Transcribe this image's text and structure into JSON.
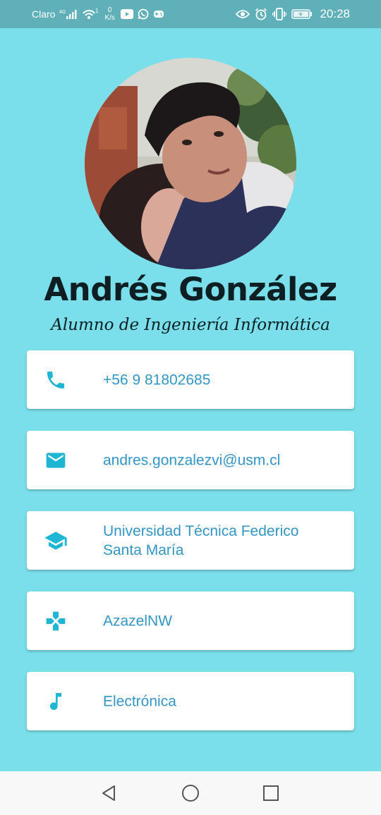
{
  "status_bar": {
    "carrier": "Claro",
    "network": "4G",
    "wifi_badge": "1",
    "speed_value": "0",
    "speed_unit": "K/s",
    "time": "20:28",
    "left_icons": [
      "signal-icon",
      "wifi-icon",
      "youtube-icon",
      "whatsapp-icon",
      "game-icon"
    ],
    "right_icons": [
      "eye-icon",
      "alarm-icon",
      "vibrate-icon",
      "battery-icon"
    ]
  },
  "profile": {
    "name": "Andrés González",
    "subtitle": "Alumno de Ingeniería Informática"
  },
  "cards": [
    {
      "icon": "phone-icon",
      "lines": [
        "+56 9 81802685"
      ]
    },
    {
      "icon": "email-icon",
      "lines": [
        "andres.gonzalezvi@usm.cl"
      ]
    },
    {
      "icon": "school-icon",
      "lines": [
        "Universidad Técnica Federico",
        "Santa María"
      ]
    },
    {
      "icon": "gamepad-icon",
      "lines": [
        "AzazelNW"
      ]
    },
    {
      "icon": "music-note-icon",
      "lines": [
        "Electrónica"
      ]
    }
  ],
  "nav_bar": {
    "buttons": [
      "back-icon",
      "home-icon",
      "recents-icon"
    ]
  },
  "colors": {
    "background": "#7ADFEA",
    "status_bar": "#5FB0B8",
    "icon": "#1FB6D3",
    "card_text": "#3396C9",
    "name_text": "#0d1f22"
  }
}
